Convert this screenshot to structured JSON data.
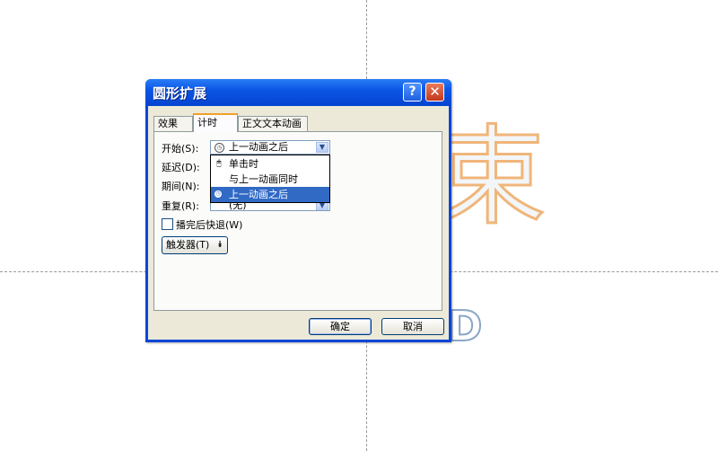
{
  "background": {
    "text": "THE END",
    "glyph": "束"
  },
  "dialog": {
    "title": "圆形扩展",
    "help_label": "?",
    "close_label": "✕",
    "tabs": [
      {
        "label": "效果"
      },
      {
        "label": "计时"
      },
      {
        "label": "正文文本动画"
      }
    ],
    "fields": {
      "start_label": "开始(S):",
      "delay_label": "延迟(D):",
      "period_label": "期间(N):",
      "repeat_label": "重复(R):",
      "start_value": "上一动画之后",
      "repeat_value": "(无)"
    },
    "dropdown_options": [
      {
        "label": "单击时",
        "icon": "mouse-icon"
      },
      {
        "label": "与上一动画同时",
        "icon": ""
      },
      {
        "label": "上一动画之后",
        "icon": "clock-icon"
      }
    ],
    "selected_option": "上一动画之后",
    "rewind_label": "播完后快退(W)",
    "rewind_checked": false,
    "trigger_label": "触发器(T)",
    "ok_label": "确定",
    "cancel_label": "取消"
  },
  "colors": {
    "titlebar": "#0b56e6",
    "selection": "#316ac5",
    "tab_highlight": "#f0a02a"
  }
}
